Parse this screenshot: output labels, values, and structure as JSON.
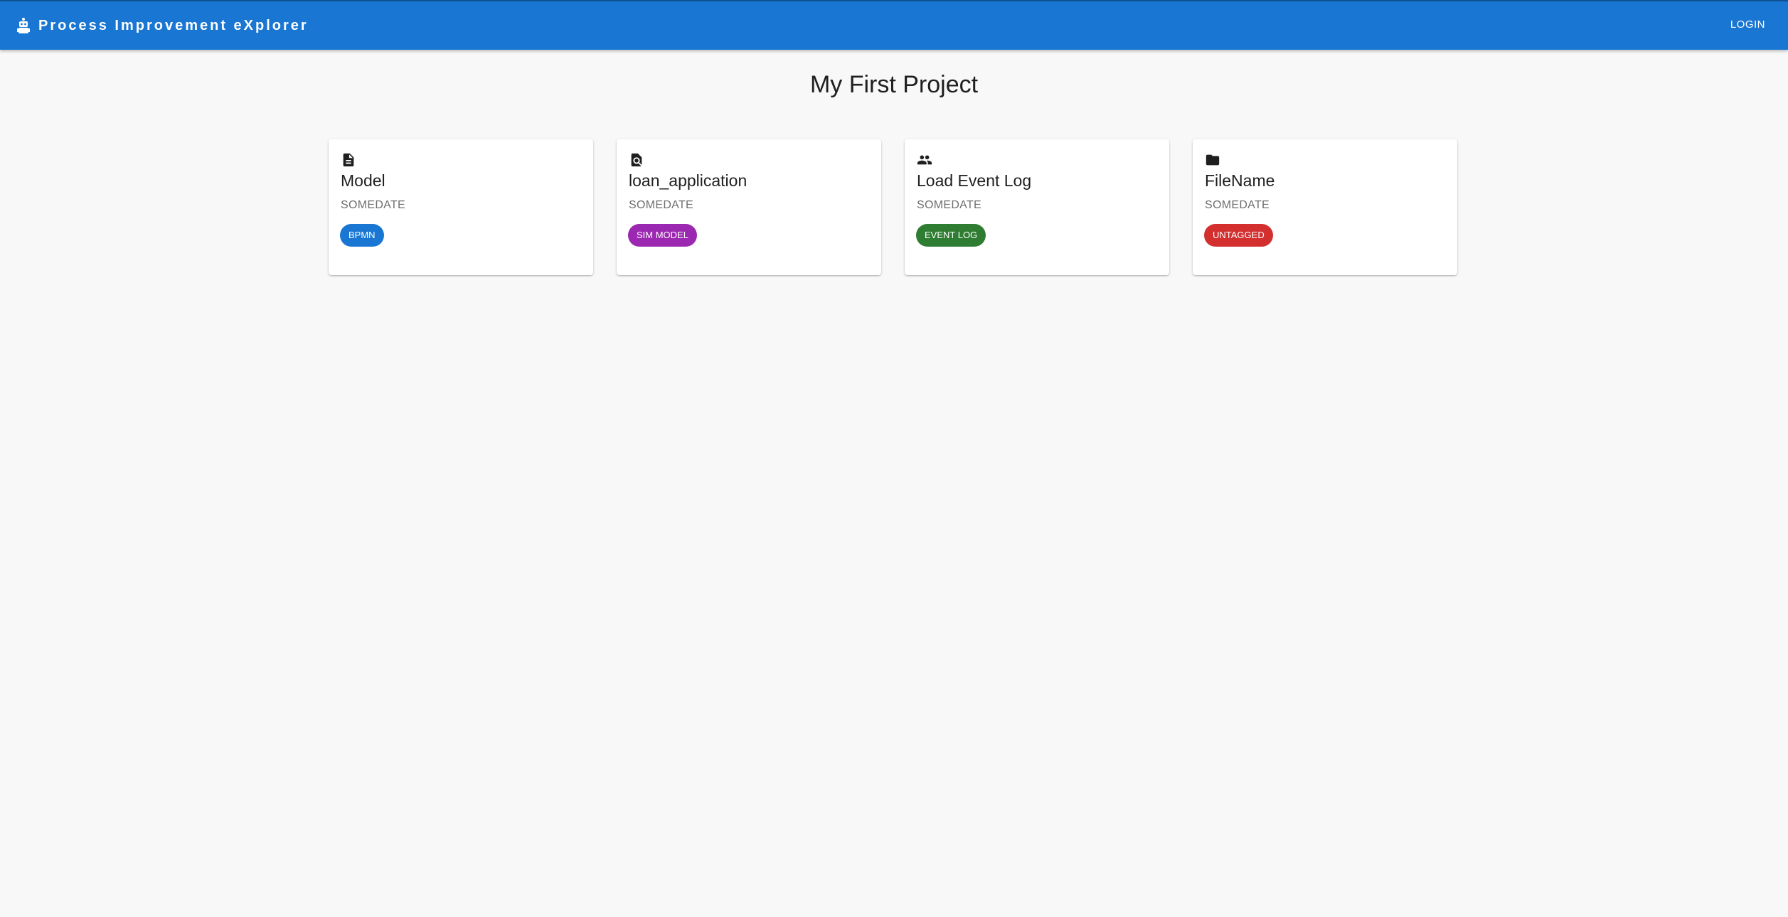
{
  "app": {
    "title": "Process Improvement eXplorer",
    "login_label": "LOGIN",
    "bar_color": "#1976d2"
  },
  "page": {
    "title": "My First Project"
  },
  "cards": [
    {
      "icon": "document-icon",
      "name": "Model",
      "date": "SOMEDATE",
      "tag": "BPMN",
      "tag_color": "#1976d2"
    },
    {
      "icon": "search-document-icon",
      "name": "loan_application",
      "date": "SOMEDATE",
      "tag": "SIM MODEL",
      "tag_color": "#9c27b0"
    },
    {
      "icon": "people-icon",
      "name": "Load Event Log",
      "date": "SOMEDATE",
      "tag": "EVENT LOG",
      "tag_color": "#2e7d32"
    },
    {
      "icon": "folder-icon",
      "name": "FileName",
      "date": "SOMEDATE",
      "tag": "UNTAGGED",
      "tag_color": "#d32f2f"
    }
  ]
}
